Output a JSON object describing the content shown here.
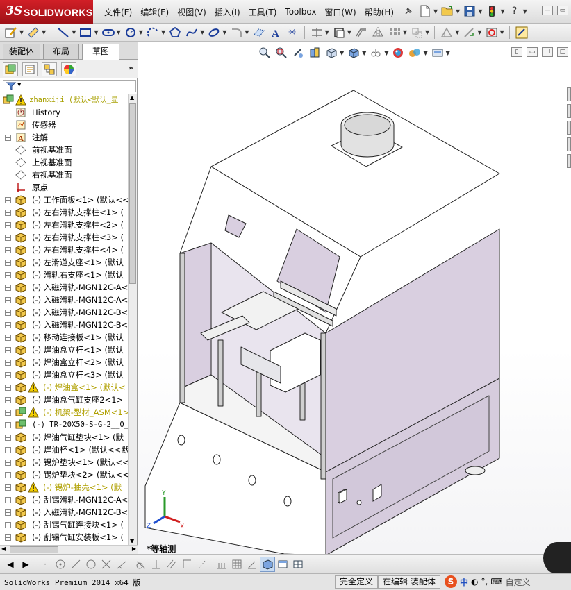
{
  "app": {
    "logo_ds": "3S",
    "logo_text": "SOLIDWORKS"
  },
  "menu": [
    "文件(F)",
    "编辑(E)",
    "视图(V)",
    "插入(I)",
    "工具(T)",
    "Toolbox",
    "窗口(W)",
    "帮助(H)"
  ],
  "panel": {
    "tabs": [
      "装配体",
      "布局",
      "草图"
    ],
    "tree": [
      {
        "label": "zhanxiji  (默认<默认_显",
        "type": "root",
        "warn": true
      },
      {
        "label": "History",
        "type": "history"
      },
      {
        "label": "传感器",
        "type": "sensor"
      },
      {
        "label": "注解",
        "type": "annotation",
        "expand": true
      },
      {
        "label": "前视基准面",
        "type": "plane"
      },
      {
        "label": "上视基准面",
        "type": "plane"
      },
      {
        "label": "右视基准面",
        "type": "plane"
      },
      {
        "label": "原点",
        "type": "origin"
      },
      {
        "label": "(-) 工作面板<1> (默认<<",
        "type": "part",
        "expand": true
      },
      {
        "label": "(-) 左右滑轨支撑柱<1> (",
        "type": "part",
        "expand": true
      },
      {
        "label": "(-) 左右滑轨支撑柱<2> (",
        "type": "part",
        "expand": true
      },
      {
        "label": "(-) 左右滑轨支撑柱<3> (",
        "type": "part",
        "expand": true
      },
      {
        "label": "(-) 左右滑轨支撑柱<4> (",
        "type": "part",
        "expand": true
      },
      {
        "label": "(-) 左滑道支座<1> (默认",
        "type": "part",
        "expand": true
      },
      {
        "label": "(-) 滑轨右支座<1> (默认",
        "type": "part",
        "expand": true
      },
      {
        "label": "(-) 入磁滑轨-MGN12C-A<1",
        "type": "part",
        "expand": true
      },
      {
        "label": "(-) 入磁滑轨-MGN12C-A<2",
        "type": "part",
        "expand": true
      },
      {
        "label": "(-) 入磁滑轨-MGN12C-B<1",
        "type": "part",
        "expand": true
      },
      {
        "label": "(-) 入磁滑轨-MGN12C-B<2",
        "type": "part",
        "expand": true
      },
      {
        "label": "(-) 移动连接板<1> (默认",
        "type": "part",
        "expand": true
      },
      {
        "label": "(-) 焊油盒立杆<1> (默认",
        "type": "part",
        "expand": true
      },
      {
        "label": "(-) 焊油盒立杆<2> (默认",
        "type": "part",
        "expand": true
      },
      {
        "label": "(-) 焊油盒立杆<3> (默认",
        "type": "part",
        "expand": true
      },
      {
        "label": "(-) 焊油盒<1> (默认<",
        "type": "part",
        "expand": true,
        "warn": true
      },
      {
        "label": "(-) 焊油盒气缸支座2<1>",
        "type": "part",
        "expand": true
      },
      {
        "label": "(-) 机架-型材_ASM<1>",
        "type": "asm",
        "expand": true,
        "warn": true
      },
      {
        "label": "(-) TR-20X50-S-G-2__0__",
        "type": "asm",
        "expand": true,
        "mono": true
      },
      {
        "label": "(-) 焊油气缸垫块<1> (默",
        "type": "part",
        "expand": true
      },
      {
        "label": "(-) 焊油杯<1> (默认<<默",
        "type": "part",
        "expand": true
      },
      {
        "label": "(-) 锡炉垫块<1> (默认<<",
        "type": "part",
        "expand": true
      },
      {
        "label": "(-) 锡炉垫块<2> (默认<<",
        "type": "part",
        "expand": true
      },
      {
        "label": "(-) 锡炉-抽壳<1> (默",
        "type": "part",
        "expand": true,
        "warn": true
      },
      {
        "label": "(-) 刮锡滑轨-MGN12C-A<1",
        "type": "part",
        "expand": true
      },
      {
        "label": "(-) 入磁滑轨-MGN12C-B<3",
        "type": "part",
        "expand": true
      },
      {
        "label": "(-) 刮锡气缸连接块<1> (",
        "type": "part",
        "expand": true
      },
      {
        "label": "(-) 刮锡气缸安装板<1> (",
        "type": "part",
        "expand": true
      }
    ]
  },
  "viewport": {
    "view_label": "*等轴测",
    "triad": {
      "x": "X",
      "y": "Y",
      "z": "Z"
    }
  },
  "status": {
    "app": "SolidWorks Premium 2014 x64 版",
    "state": "完全定义",
    "mode": "在编辑 装配体",
    "ime": "中",
    "custom": "自定义"
  },
  "colors": {
    "brand": "#c8151d",
    "panel_fill": "#d9cfe0",
    "sheet": "#ffffff"
  }
}
